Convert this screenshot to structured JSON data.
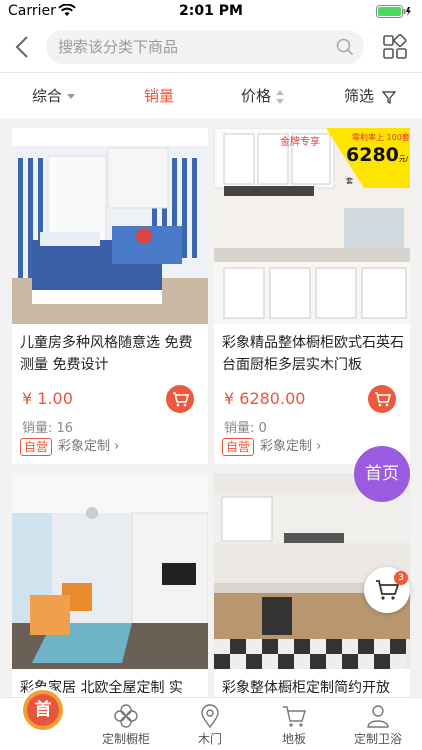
{
  "status_bar": {
    "carrier": "Carrier",
    "time": "2:01 PM"
  },
  "header": {
    "search_placeholder": "搜索该分类下商品"
  },
  "sort_tabs": [
    {
      "label": "综合"
    },
    {
      "label": "销量"
    },
    {
      "label": "价格"
    },
    {
      "label": "筛选"
    }
  ],
  "products": [
    {
      "title": "儿童房多种风格随意选 免费测量 免费设计",
      "price": "¥ 1.00",
      "sales": "销量:  16",
      "badge": "自营",
      "shop": "彩象定制"
    },
    {
      "title": "彩象精品整体橱柜欧式石英石台面厨柜多层实木门板",
      "price": "¥ 6280.00",
      "sales": "销量:  0",
      "badge": "自营",
      "shop": "彩象定制",
      "promo": {
        "tag": "金牌专享",
        "note": "零利率上 100套",
        "price": "6280",
        "unit": "元/套"
      }
    },
    {
      "title": "彩象家居 北欧全屋定制 实",
      "price": "",
      "sales": "",
      "badge": "",
      "shop": ""
    },
    {
      "title": "彩象整体橱柜定制简约开放",
      "price": "",
      "sales": "",
      "badge": "",
      "shop": ""
    }
  ],
  "float": {
    "home_label": "首页",
    "cart_count": "3"
  },
  "tabbar": [
    {
      "label": "",
      "icon": "home-logo-icon",
      "logo_text": "首"
    },
    {
      "label": "定制橱柜",
      "icon": "flower-icon"
    },
    {
      "label": "木门",
      "icon": "location-pin-icon"
    },
    {
      "label": "地板",
      "icon": "cart-icon"
    },
    {
      "label": "定制卫浴",
      "icon": "person-icon"
    }
  ],
  "colors": {
    "accent": "#e8553e",
    "float_home": "#9b5be0",
    "home_logo": "#f0a030"
  }
}
